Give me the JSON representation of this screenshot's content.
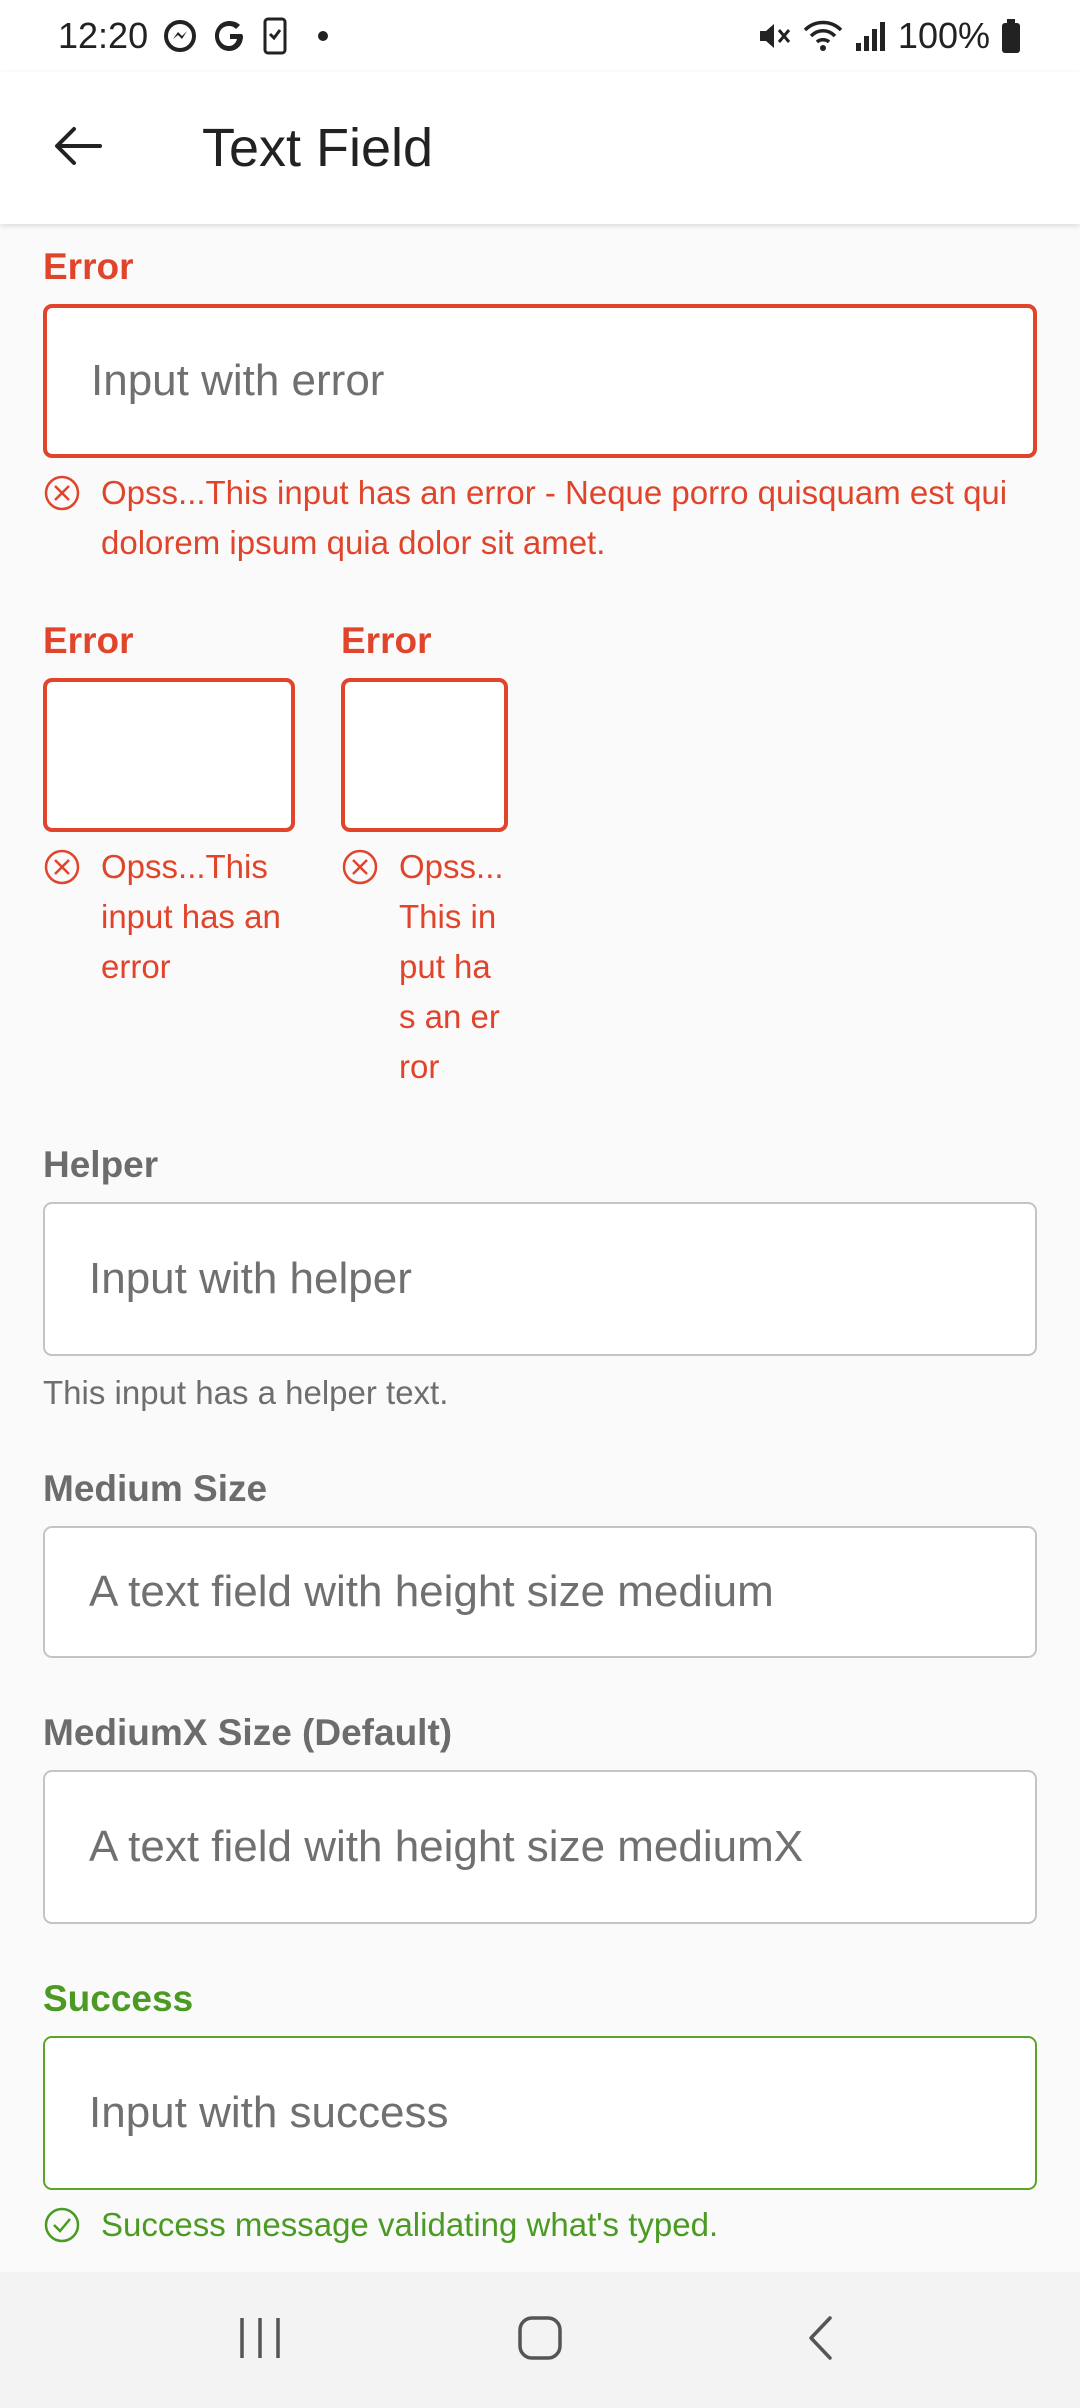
{
  "status_bar": {
    "time": "12:20",
    "battery": "100%",
    "icons": [
      "messenger-icon",
      "google-icon",
      "phone-check-icon",
      "dot-icon",
      "mute-icon",
      "wifi-icon",
      "signal-icon",
      "battery-icon"
    ]
  },
  "app_bar": {
    "title": "Text Field",
    "back_icon": "arrow-left-icon"
  },
  "sections": {
    "error_full": {
      "label": "Error",
      "placeholder": "Input with error",
      "message": "Opss...This input has an error - Neque porro quisquam est qui dolorem ipsum quia dolor sit amet."
    },
    "error_small_1": {
      "label": "Error",
      "message": "Opss...This input has an error"
    },
    "error_small_2": {
      "label": "Error",
      "message": "Opss...This input has an error"
    },
    "helper": {
      "label": "Helper",
      "placeholder": "Input with helper",
      "message": "This input has a helper text."
    },
    "medium": {
      "label": "Medium Size",
      "placeholder": "A text field with height size medium"
    },
    "mediumx": {
      "label": "MediumX Size (Default)",
      "placeholder": "A text field with height size mediumX"
    },
    "success": {
      "label": "Success",
      "placeholder": "Input with success",
      "message": "Success message validating what's typed."
    }
  },
  "colors": {
    "error": "#e0452b",
    "success": "#4a9a23",
    "label": "#6c6c6c",
    "border": "#c4c4c4"
  },
  "nav_bar": {
    "icons": [
      "recent-apps-icon",
      "home-icon",
      "back-icon"
    ]
  }
}
